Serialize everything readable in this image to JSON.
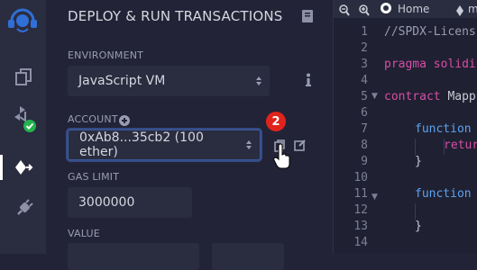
{
  "panel": {
    "title": "DEPLOY & RUN TRANSACTIONS",
    "environment_label": "ENVIRONMENT",
    "environment_value": "JavaScript VM",
    "account_label": "ACCOUNT",
    "account_value": "0xAb8...35cb2 (100 ether)",
    "gas_limit_label": "GAS LIMIT",
    "gas_limit_value": "3000000",
    "value_label": "VALUE"
  },
  "annotation": {
    "step_badge": "2"
  },
  "editor": {
    "home_tab": "Home",
    "file_tab_partial": "m",
    "line_numbers": [
      "1",
      "2",
      "3",
      "4",
      "5",
      "6",
      "7",
      "8",
      "9",
      "10",
      "11",
      "12",
      "13",
      "14"
    ],
    "lines": {
      "l1": "//SPDX-Licens",
      "l3_keyword": "pragma",
      "l3_rest": " solidi",
      "l5_keyword": "contract",
      "l5_rest": " Mapp",
      "l7": "function",
      "l8": "retur",
      "l9": "}",
      "l11": "function",
      "l13": "}"
    }
  },
  "colors": {
    "accent_blue": "#2f6fd6",
    "badge_red": "#e0241b",
    "success_green": "#22b24c",
    "keyword_pink": "#d64ea7",
    "comment_gray": "#9a9db1",
    "function_blue": "#5ea2ef"
  }
}
